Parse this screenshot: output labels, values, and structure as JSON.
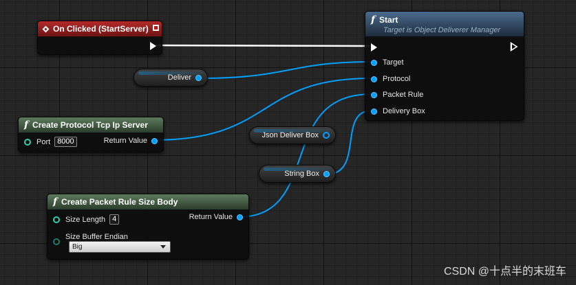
{
  "nodes": {
    "on_clicked": {
      "title": "On Clicked (StartServer)"
    },
    "start": {
      "title": "Start",
      "subtitle": "Target is Object Deliverer Manager",
      "pins": [
        "Target",
        "Protocol",
        "Packet Rule",
        "Delivery Box"
      ]
    },
    "create_protocol": {
      "title": "Create Protocol Tcp Ip Server",
      "port_label": "Port",
      "port_value": "8000",
      "return_label": "Return Value"
    },
    "create_packet_rule": {
      "title": "Create Packet Rule Size Body",
      "size_length_label": "Size Length",
      "size_length_value": "4",
      "return_label": "Return Value",
      "endian_label": "Size Buffer Endian",
      "endian_value": "Big"
    }
  },
  "variables": {
    "deliver": "Deliver",
    "json_deliver_box": "Json Deliver Box",
    "string_box": "String Box"
  },
  "watermark": "CSDN @十点半的末班车",
  "colors": {
    "exec_wire": "#ffffff",
    "object_wire": "#00a0ff",
    "event_header": "#b32a2a",
    "function_header": "#5c7a5c",
    "start_header": "#4a6b8c"
  }
}
